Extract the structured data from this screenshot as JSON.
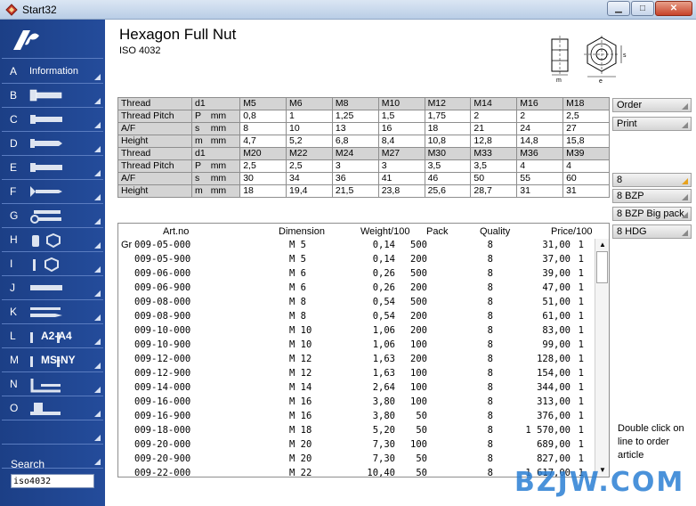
{
  "window": {
    "title": "Start32"
  },
  "product": {
    "title": "Hexagon Full Nut",
    "standard": "ISO 4032"
  },
  "drawing": {
    "label_m": "m",
    "label_s": "s",
    "label_e": "e"
  },
  "sidebar": {
    "items": [
      {
        "letter": "A",
        "label": "Information"
      },
      {
        "letter": "B",
        "label": ""
      },
      {
        "letter": "C",
        "label": ""
      },
      {
        "letter": "D",
        "label": ""
      },
      {
        "letter": "E",
        "label": ""
      },
      {
        "letter": "F",
        "label": ""
      },
      {
        "letter": "G",
        "label": ""
      },
      {
        "letter": "H",
        "label": ""
      },
      {
        "letter": "I",
        "label": ""
      },
      {
        "letter": "J",
        "label": ""
      },
      {
        "letter": "K",
        "label": ""
      },
      {
        "letter": "L",
        "label": "A2-A4"
      },
      {
        "letter": "M",
        "label": "MS-NY"
      },
      {
        "letter": "N",
        "label": ""
      },
      {
        "letter": "O",
        "label": ""
      },
      {
        "letter": "",
        "label": ""
      },
      {
        "letter": "",
        "label": ""
      }
    ],
    "search_label": "Search",
    "search_value": "iso4032"
  },
  "spec": {
    "top": {
      "rows": [
        {
          "label": "Thread",
          "sym": "d1",
          "unit": "",
          "vals": [
            "M5",
            "M6",
            "M8",
            "M10",
            "M12",
            "M14",
            "M16",
            "M18"
          ]
        },
        {
          "label": "Thread Pitch",
          "sym": "P",
          "unit": "mm",
          "vals": [
            "0,8",
            "1",
            "1,25",
            "1,5",
            "1,75",
            "2",
            "2",
            "2,5"
          ]
        },
        {
          "label": "A/F",
          "sym": "s",
          "unit": "mm",
          "vals": [
            "8",
            "10",
            "13",
            "16",
            "18",
            "21",
            "24",
            "27"
          ]
        },
        {
          "label": "Height",
          "sym": "m",
          "unit": "mm",
          "vals": [
            "4,7",
            "5,2",
            "6,8",
            "8,4",
            "10,8",
            "12,8",
            "14,8",
            "15,8"
          ]
        }
      ]
    },
    "bottom": {
      "rows": [
        {
          "label": "Thread",
          "sym": "d1",
          "unit": "",
          "vals": [
            "M20",
            "M22",
            "M24",
            "M27",
            "M30",
            "M33",
            "M36",
            "M39"
          ]
        },
        {
          "label": "Thread Pitch",
          "sym": "P",
          "unit": "mm",
          "vals": [
            "2,5",
            "2,5",
            "3",
            "3",
            "3,5",
            "3,5",
            "4",
            "4"
          ]
        },
        {
          "label": "A/F",
          "sym": "s",
          "unit": "mm",
          "vals": [
            "30",
            "34",
            "36",
            "41",
            "46",
            "50",
            "55",
            "60"
          ]
        },
        {
          "label": "Height",
          "sym": "m",
          "unit": "mm",
          "vals": [
            "18",
            "19,4",
            "21,5",
            "23,8",
            "25,6",
            "28,7",
            "31",
            "31"
          ]
        }
      ]
    }
  },
  "articles": {
    "headers": {
      "artno": "Art.no",
      "dimension": "Dimension",
      "weight": "Weight/100",
      "pack": "Pack",
      "quality": "Quality",
      "price": "Price/100"
    },
    "prefix": "Gr",
    "rows": [
      {
        "artno": "009-05-000",
        "dim": "M 5",
        "weight": "0,14",
        "pack": "500",
        "quality": "8",
        "price": "31,00",
        "unit": "1"
      },
      {
        "artno": "009-05-900",
        "dim": "M 5",
        "weight": "0,14",
        "pack": "200",
        "quality": "8",
        "price": "37,00",
        "unit": "1"
      },
      {
        "artno": "009-06-000",
        "dim": "M 6",
        "weight": "0,26",
        "pack": "500",
        "quality": "8",
        "price": "39,00",
        "unit": "1"
      },
      {
        "artno": "009-06-900",
        "dim": "M 6",
        "weight": "0,26",
        "pack": "200",
        "quality": "8",
        "price": "47,00",
        "unit": "1"
      },
      {
        "artno": "009-08-000",
        "dim": "M 8",
        "weight": "0,54",
        "pack": "500",
        "quality": "8",
        "price": "51,00",
        "unit": "1"
      },
      {
        "artno": "009-08-900",
        "dim": "M 8",
        "weight": "0,54",
        "pack": "200",
        "quality": "8",
        "price": "61,00",
        "unit": "1"
      },
      {
        "artno": "009-10-000",
        "dim": "M 10",
        "weight": "1,06",
        "pack": "200",
        "quality": "8",
        "price": "83,00",
        "unit": "1"
      },
      {
        "artno": "009-10-900",
        "dim": "M 10",
        "weight": "1,06",
        "pack": "100",
        "quality": "8",
        "price": "99,00",
        "unit": "1"
      },
      {
        "artno": "009-12-000",
        "dim": "M 12",
        "weight": "1,63",
        "pack": "200",
        "quality": "8",
        "price": "128,00",
        "unit": "1"
      },
      {
        "artno": "009-12-900",
        "dim": "M 12",
        "weight": "1,63",
        "pack": "100",
        "quality": "8",
        "price": "154,00",
        "unit": "1"
      },
      {
        "artno": "009-14-000",
        "dim": "M 14",
        "weight": "2,64",
        "pack": "100",
        "quality": "8",
        "price": "344,00",
        "unit": "1"
      },
      {
        "artno": "009-16-000",
        "dim": "M 16",
        "weight": "3,80",
        "pack": "100",
        "quality": "8",
        "price": "313,00",
        "unit": "1"
      },
      {
        "artno": "009-16-900",
        "dim": "M 16",
        "weight": "3,80",
        "pack": "50",
        "quality": "8",
        "price": "376,00",
        "unit": "1"
      },
      {
        "artno": "009-18-000",
        "dim": "M 18",
        "weight": "5,20",
        "pack": "50",
        "quality": "8",
        "price": "1 570,00",
        "unit": "1"
      },
      {
        "artno": "009-20-000",
        "dim": "M 20",
        "weight": "7,30",
        "pack": "100",
        "quality": "8",
        "price": "689,00",
        "unit": "1"
      },
      {
        "artno": "009-20-900",
        "dim": "M 20",
        "weight": "7,30",
        "pack": "50",
        "quality": "8",
        "price": "827,00",
        "unit": "1"
      },
      {
        "artno": "009-22-000",
        "dim": "M 22",
        "weight": "10,40",
        "pack": "50",
        "quality": "8",
        "price": "1 617,00",
        "unit": "1"
      }
    ]
  },
  "right_panel": {
    "order_label": "Order",
    "print_label": "Print",
    "quality_buttons": [
      "8",
      "8 BZP",
      "8 BZP Big pack",
      "8 HDG"
    ],
    "hint": "Double click on line to order article"
  },
  "watermark": "BZJW.COM"
}
